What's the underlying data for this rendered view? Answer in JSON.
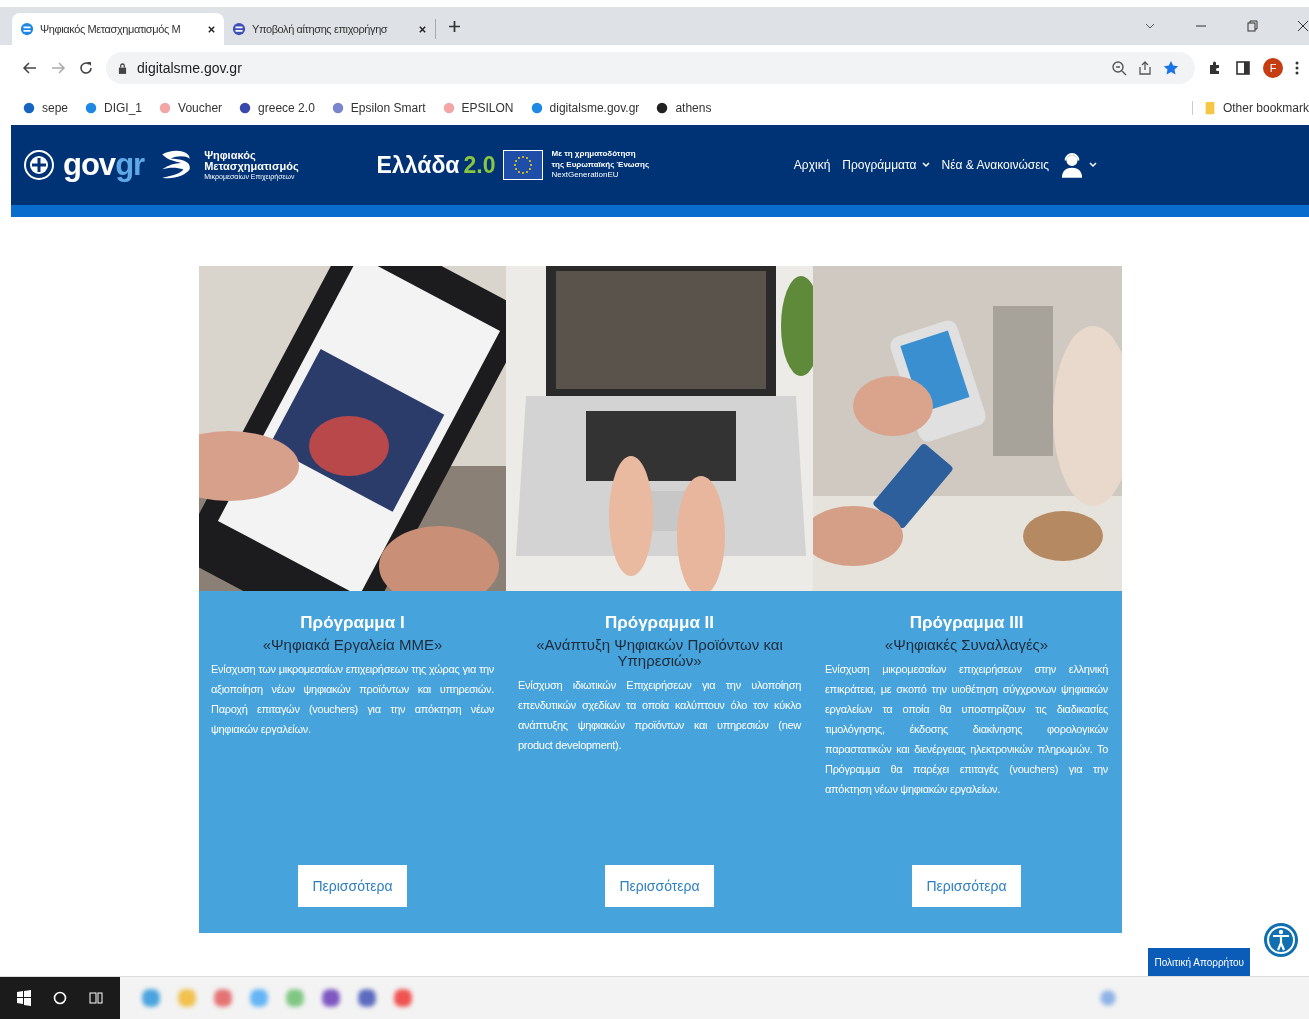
{
  "browser": {
    "tabs": [
      {
        "title": "Ψηφιακός Μετασχηματισμός Μ",
        "selected": true
      },
      {
        "title": "Υποβολή αίτησης επιχορήγησ",
        "selected": false
      }
    ],
    "address": "digitalsme.gov.gr",
    "bookmarks": [
      "sepe",
      "DIGI_1",
      "Voucher",
      "greece 2.0",
      "Epsilon Smart",
      "EPSILON",
      "digitalsme.gov.gr",
      "athens"
    ],
    "other_bookmarks": "Other bookmark",
    "profile_initial": "F"
  },
  "header": {
    "logo_parts": [
      "gov",
      "gr"
    ],
    "brand_lines": [
      "Ψηφιακός",
      "Μετασχηματισμός",
      "Μικρομεσαίων Επιχειρήσεων"
    ],
    "greece_parts": [
      "Ελλάδα",
      "2.0"
    ],
    "eu_lines": [
      "Με τη χρηματοδότηση",
      "της Ευρωπαϊκής Ένωσης",
      "NextGenerationEU"
    ],
    "nav": [
      {
        "label": "Αρχική",
        "dropdown": false
      },
      {
        "label": "Προγράμματα",
        "dropdown": true
      },
      {
        "label": "Νέα & Ανακοινώσεις",
        "dropdown": false
      }
    ]
  },
  "programs": [
    {
      "title": "Πρόγραμμα I",
      "subtitle": "«Ψηφιακά Εργαλεία ΜΜΕ»",
      "text": "Ενίσχυση των μικρομεσαίων επιχειρήσεων της χώρας για την αξιοποίηση νέων ψηφιακών προϊόντων και υπηρεσιών. Παροχή επιταγών (vouchers) για την απόκτηση νέων ψηφιακών εργαλείων.",
      "button": "Περισσότερα"
    },
    {
      "title": "Πρόγραμμα II",
      "subtitle": "«Ανάπτυξη Ψηφιακών Προϊόντων και Υπηρεσιών»",
      "text": "Ενίσχυση ιδιωτικών Επιχειρήσεων για την υλοποίηση επενδυτικών σχεδίων τα οποία καλύπτουν όλο τον κύκλο ανάπτυξης ψηφιακών προϊόντων και υπηρεσιών (new product development).",
      "button": "Περισσότερα"
    },
    {
      "title": "Πρόγραμμα III",
      "subtitle": "«Ψηφιακές Συναλλαγές»",
      "text": "Ενίσχυση μικρομεσαίων επιχειρήσεων στην ελληνική επικράτεια, με σκοπό την υιοθέτηση σύγχρονων ψηφιακών εργαλείων τα οποία θα υποστηρίζουν τις διαδικασίες τιμολόγησης, έκδοσης διακίνησης φορολογικών παραστατικών και διενέργειας ηλεκτρονικών πληρωμών. Το Πρόγραμμα θα παρέχει επιταγές (vouchers) για την απόκτηση νέων ψηφιακών εργαλείων.",
      "button": "Περισσότερα"
    }
  ],
  "privacy_button": "Πολιτική Απορρήτου"
}
